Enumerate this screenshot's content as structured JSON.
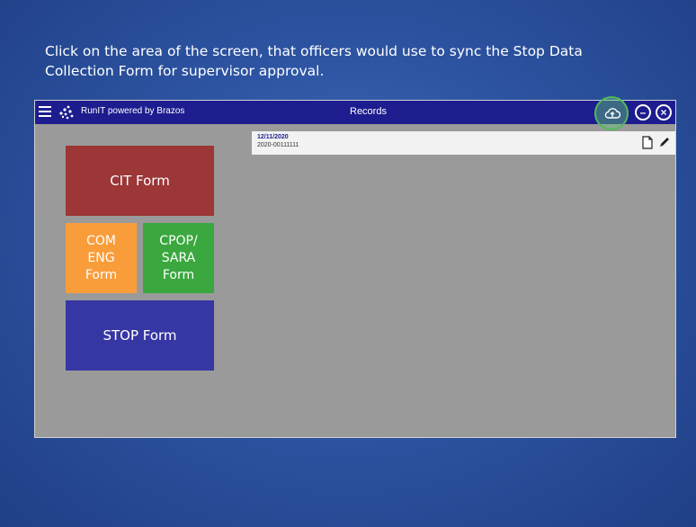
{
  "instruction": {
    "line1": "Click on the area of the screen, that officers would use to sync the Stop Data",
    "line2": "Collection Form for supervisor approval."
  },
  "app": {
    "app_name": "RunIT powered by Brazos",
    "window_title": "Records",
    "icons": [
      "menu-icon",
      "brazos-logo-icon",
      "cloud-upload-icon",
      "minus-circle-icon",
      "close-circle-icon"
    ]
  },
  "tiles": {
    "cit": "CIT Form",
    "com": [
      "COM",
      "ENG",
      "Form"
    ],
    "cpop": [
      "CPOP/",
      "SARA",
      "Form"
    ],
    "stop": "STOP Form"
  },
  "record": {
    "date": "12/11/2020",
    "id": "2020-00111111"
  },
  "colors": {
    "titlebar": "#1d1d8f",
    "cit": "#9c3637",
    "com": "#f99d3b",
    "cpop": "#3aa83e",
    "stop": "#3636a4",
    "highlight": "#52b85a"
  }
}
